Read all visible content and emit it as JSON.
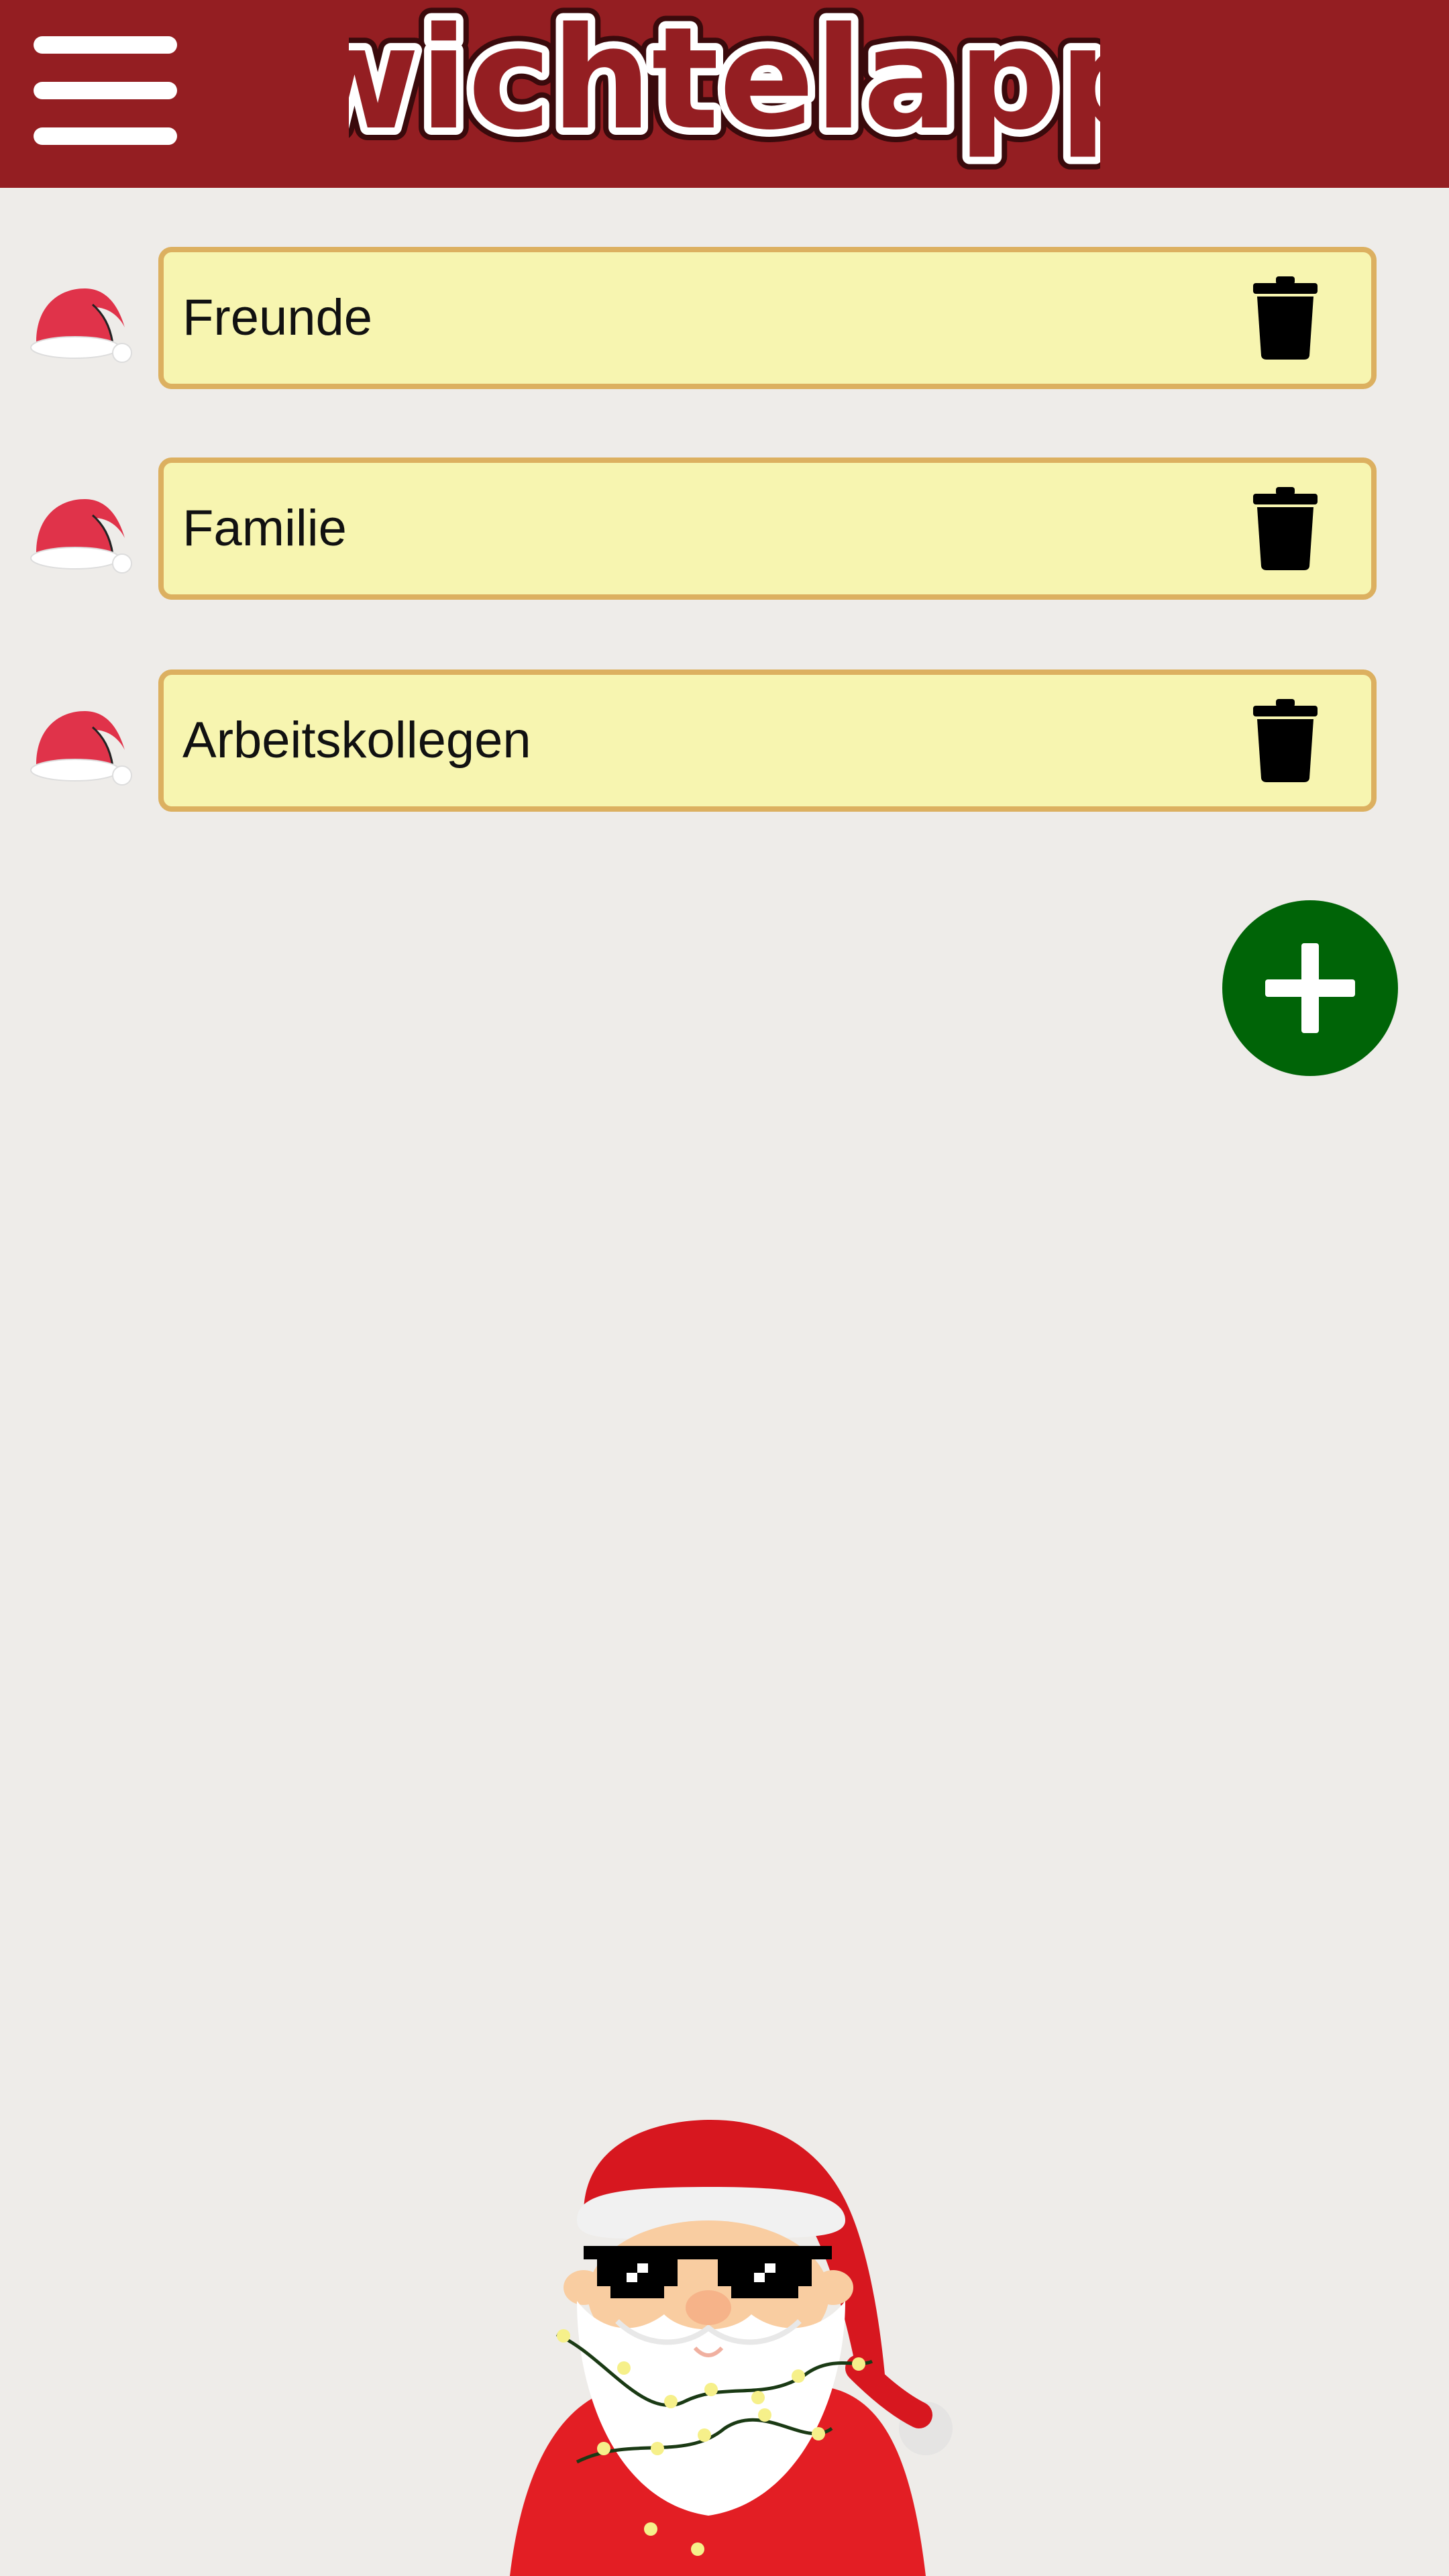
{
  "app": {
    "title": "wichtelapp",
    "colors": {
      "header_bg": "#941e22",
      "page_bg": "#eeece9",
      "card_bg": "#f7f5b0",
      "card_border": "#dcb060",
      "fab_bg": "#006407"
    }
  },
  "header": {
    "menu_icon": "hamburger-menu-icon",
    "logo_text": "wichtelapp"
  },
  "groups": [
    {
      "name": "Freunde",
      "icon": "santa-hat-icon",
      "action_icon": "trash-icon"
    },
    {
      "name": "Familie",
      "icon": "santa-hat-icon",
      "action_icon": "trash-icon"
    },
    {
      "name": "Arbeitskollegen",
      "icon": "santa-hat-icon",
      "action_icon": "trash-icon"
    }
  ],
  "fab": {
    "icon": "plus-icon"
  },
  "mascot": {
    "icon": "santa-sunglasses-illustration"
  }
}
